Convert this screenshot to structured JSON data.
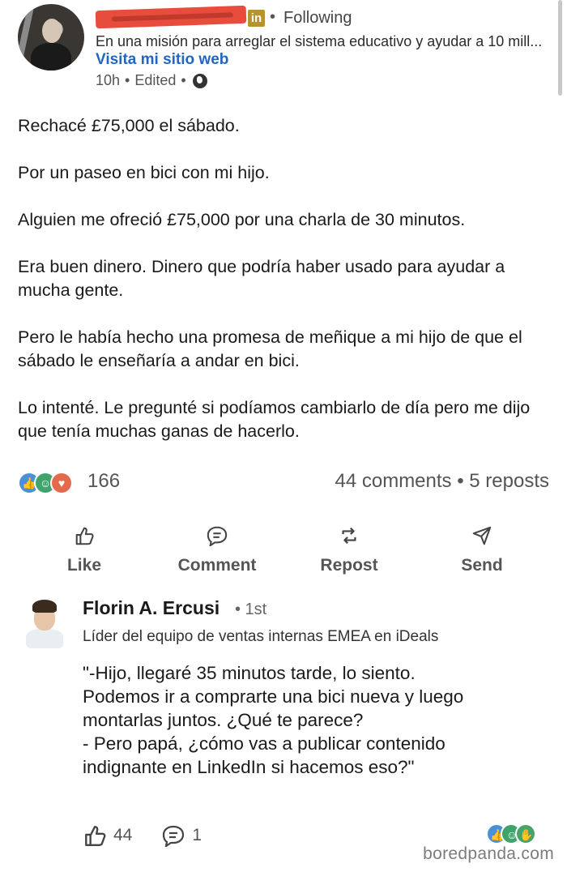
{
  "post": {
    "author_badge": "in",
    "following_label": "Following",
    "tagline": "En una misión para arreglar el sistema educativo y ayudar a 10 mill...",
    "website_link": "Visita mi sitio web",
    "time": "10h",
    "edited": "Edited",
    "body": [
      "Rechacé £75,000 el sábado.",
      "Por un paseo en bici con mi hijo.",
      "Alguien me ofreció £75,000 por una charla de 30 minutos.",
      "Era buen dinero. Dinero que podría haber usado para ayudar a mucha gente.",
      "Pero le había hecho una promesa de meñique a mi hijo de que el sábado le enseñaría a andar en bici.",
      "Lo intenté. Le pregunté si podíamos cambiarlo de día pero me dijo que tenía muchas ganas de hacerlo."
    ],
    "reaction_count": "166",
    "comments_reposts": "44 comments • 5 reposts"
  },
  "actions": {
    "like": "Like",
    "comment": "Comment",
    "repost": "Repost",
    "send": "Send"
  },
  "comment": {
    "author": "Florin A. Ercusi",
    "degree": "• 1st",
    "title": "Líder del equipo de ventas internas EMEA en iDeals",
    "lines": [
      "\"-Hijo, llegaré 35 minutos tarde, lo siento.",
      "Podemos ir a comprarte una bici nueva y luego",
      "montarlas juntos. ¿Qué te parece?",
      "- Pero papá, ¿cómo vas a publicar contenido",
      "indignante en LinkedIn si hacemos eso?\""
    ],
    "likes": "44",
    "replies": "1"
  },
  "watermark": "boredpanda.com",
  "colors": {
    "link": "#2266c4",
    "redaction": "#e74c3c",
    "li_badge": "#b8922e"
  }
}
